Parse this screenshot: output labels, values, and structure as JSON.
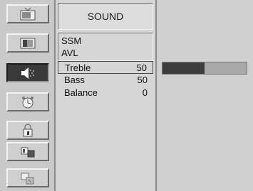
{
  "menu": {
    "title": "SOUND",
    "items": [
      "SSM",
      "AVL"
    ],
    "settings": [
      {
        "label": "Treble",
        "value": "50",
        "selected": true
      },
      {
        "label": "Bass",
        "value": "50",
        "selected": false
      },
      {
        "label": "Balance",
        "value": "0",
        "selected": false
      }
    ]
  },
  "sidebar": {
    "icons": [
      "tv-icon",
      "picture-icon",
      "sound-icon",
      "timer-icon",
      "lock-icon",
      "features-icon",
      "install-icon"
    ],
    "active_index": 2
  },
  "treble_level": 0.5,
  "colors": {
    "bar_fill": "#3d3d3d",
    "bar_track": "#a8a8a8",
    "active_tile": "#3a3a3a"
  }
}
